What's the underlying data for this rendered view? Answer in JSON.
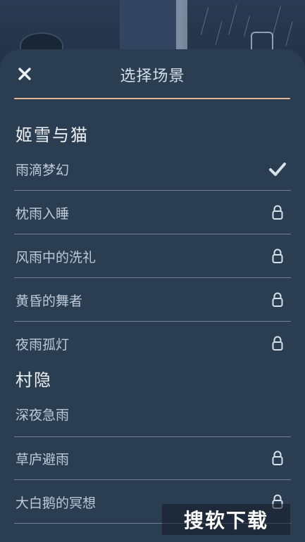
{
  "sheet": {
    "title": "选择场景",
    "close_icon": "close-icon"
  },
  "groups": [
    {
      "title": "姬雪与猫",
      "items": [
        {
          "label": "雨滴梦幻",
          "status": "selected",
          "icon": "checkmark-icon"
        },
        {
          "label": "枕雨入睡",
          "status": "locked",
          "icon": "lock-icon"
        },
        {
          "label": "风雨中的洗礼",
          "status": "locked",
          "icon": "lock-icon"
        },
        {
          "label": "黄昏的舞者",
          "status": "locked",
          "icon": "lock-icon"
        },
        {
          "label": "夜雨孤灯",
          "status": "locked",
          "icon": "lock-icon"
        }
      ]
    },
    {
      "title": "村隐",
      "items": [
        {
          "label": "深夜急雨",
          "status": "unlocked",
          "icon": ""
        },
        {
          "label": "草庐避雨",
          "status": "locked",
          "icon": "lock-icon"
        },
        {
          "label": "大白鹅的冥想",
          "status": "locked",
          "icon": "lock-icon"
        }
      ]
    }
  ],
  "watermark": {
    "text": "搜软下载"
  },
  "colors": {
    "sheet_bg": "#2a3d51",
    "accent_underline": "#e0b894",
    "text_primary": "#eef2f6",
    "text_secondary": "#bfcad6",
    "icon": "#d8e0ea"
  }
}
